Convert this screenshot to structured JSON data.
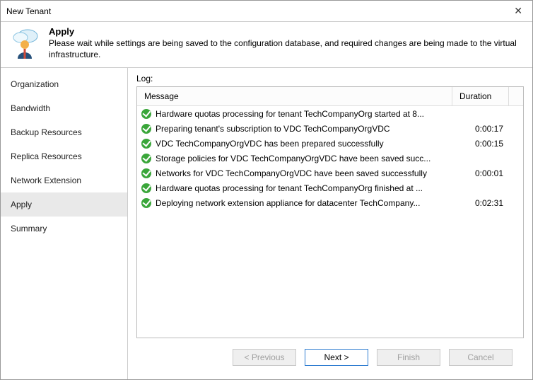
{
  "window": {
    "title": "New Tenant"
  },
  "header": {
    "title": "Apply",
    "description": "Please wait while settings are being saved to the configuration database, and required changes are being made to the virtual infrastructure."
  },
  "sidebar": [
    "Organization",
    "Bandwidth",
    "Backup Resources",
    "Replica Resources",
    "Network Extension",
    "Apply",
    "Summary"
  ],
  "content": {
    "log_label": "Log:",
    "columns": [
      "Message",
      "Duration"
    ],
    "rows": [
      {
        "status": "ok",
        "message": "Hardware quotas processing for tenant TechCompanyOrg started at 8...",
        "duration": ""
      },
      {
        "status": "ok",
        "message": "Preparing tenant's subscription to VDC TechCompanyOrgVDC",
        "duration": "0:00:17"
      },
      {
        "status": "ok",
        "message": "VDC TechCompanyOrgVDC has been prepared successfully",
        "duration": "0:00:15"
      },
      {
        "status": "ok",
        "message": "Storage policies for VDC TechCompanyOrgVDC have been saved succ...",
        "duration": ""
      },
      {
        "status": "ok",
        "message": "Networks for VDC TechCompanyOrgVDC have been saved successfully",
        "duration": "0:00:01"
      },
      {
        "status": "ok",
        "message": "Hardware quotas processing for tenant TechCompanyOrg finished at ...",
        "duration": ""
      },
      {
        "status": "ok",
        "message": "Deploying network extension appliance for datacenter TechCompany...",
        "duration": "0:02:31"
      }
    ]
  },
  "buttons": {
    "previous": "< Previous",
    "next": "Next >",
    "finish": "Finish",
    "cancel": "Cancel"
  }
}
